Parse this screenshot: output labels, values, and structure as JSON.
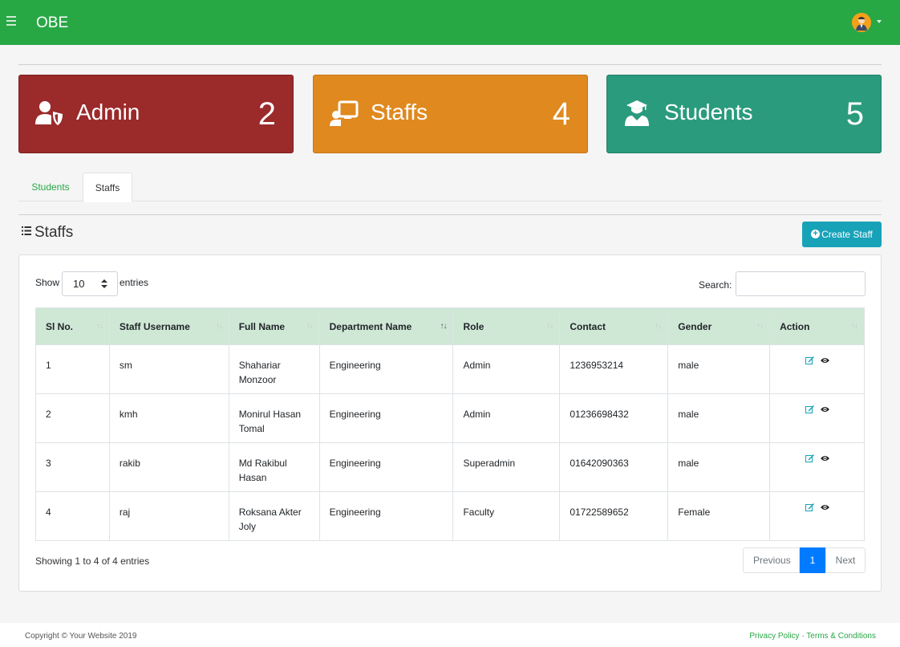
{
  "navbar": {
    "brand": "OBE",
    "menu_icon": "hamburger-icon",
    "avatar_icon": "user-avatar-icon",
    "color": "#28a745"
  },
  "cards": [
    {
      "label": "Admin",
      "count": "2",
      "icon": "user-shield-icon",
      "color": "#9b2a2b"
    },
    {
      "label": "Staffs",
      "count": "4",
      "icon": "chalkboard-teacher-icon",
      "color": "#e0891f"
    },
    {
      "label": "Students",
      "count": "5",
      "icon": "user-graduate-icon",
      "color": "#2a9b7d"
    }
  ],
  "tabs": [
    {
      "label": "Students",
      "active": false
    },
    {
      "label": "Staffs",
      "active": true
    }
  ],
  "section": {
    "title": "Staffs",
    "icon": "list-icon",
    "create_button": "Create Staff"
  },
  "table_controls": {
    "show_label": "Show",
    "page_size": "10",
    "entries_label": "entries",
    "search_label": "Search:"
  },
  "table": {
    "columns": [
      "Sl No.",
      "Staff Username",
      "Full Name",
      "Department Name",
      "Role",
      "Contact",
      "Gender",
      "Action"
    ],
    "rows": [
      {
        "sl": "1",
        "username": "sm",
        "full_name": "Shahariar Monzoor",
        "department": "Engineering",
        "role": "Admin",
        "contact": "1236953214",
        "gender": "male"
      },
      {
        "sl": "2",
        "username": "kmh",
        "full_name": "Monirul Hasan Tomal",
        "department": "Engineering",
        "role": "Admin",
        "contact": "01236698432",
        "gender": "male"
      },
      {
        "sl": "3",
        "username": "rakib",
        "full_name": "Md Rakibul Hasan",
        "department": "Engineering",
        "role": "Superadmin",
        "contact": "01642090363",
        "gender": "male"
      },
      {
        "sl": "4",
        "username": "raj",
        "full_name": "Roksana Akter Joly",
        "department": "Engineering",
        "role": "Faculty",
        "contact": "01722589652",
        "gender": "Female"
      }
    ]
  },
  "pagination": {
    "info": "Showing 1 to 4 of 4 entries",
    "previous": "Previous",
    "current": "1",
    "next": "Next"
  },
  "footer": {
    "copyright": "Copyright © Your Website 2019",
    "privacy": "Privacy Policy",
    "separator": "·",
    "terms": "Terms & Conditions"
  }
}
